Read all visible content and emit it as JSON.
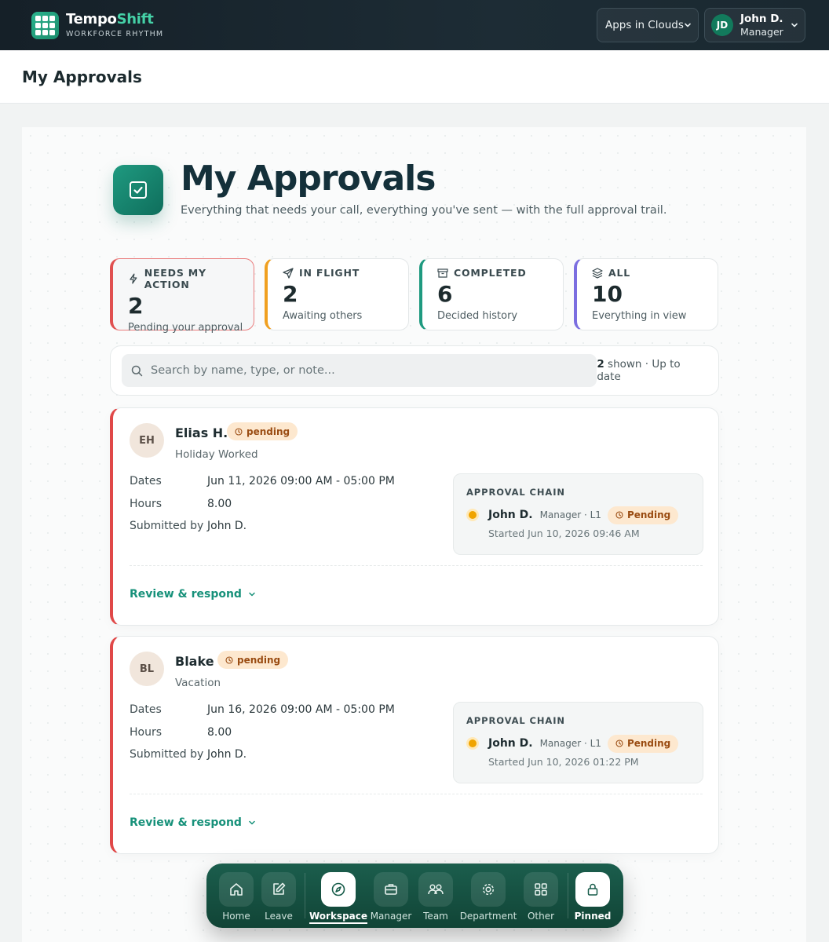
{
  "app": {
    "brand_name_part1": "Tempo",
    "brand_name_part2": "Shift",
    "brand_tagline": "WORKFORCE RHYTHM",
    "org_select": "Apps in Clouds",
    "user": {
      "initials": "JD",
      "name": "John D.",
      "role": "Manager"
    }
  },
  "page": {
    "title_bar": "My Approvals",
    "hero_title": "My Approvals",
    "hero_subtitle": "Everything that needs your call, everything you've sent — with the full approval trail."
  },
  "stats": [
    {
      "label": "NEEDS MY ACTION",
      "value": "2",
      "caption": "Pending your approval",
      "color": "#e05050",
      "icon": "bolt-icon"
    },
    {
      "label": "IN FLIGHT",
      "value": "2",
      "caption": "Awaiting others",
      "color": "#f0a020",
      "icon": "send-icon"
    },
    {
      "label": "COMPLETED",
      "value": "6",
      "caption": "Decided history",
      "color": "#1f9a80",
      "icon": "archive-icon"
    },
    {
      "label": "ALL",
      "value": "10",
      "caption": "Everything in view",
      "color": "#7b6ee0",
      "icon": "layers-icon"
    }
  ],
  "search": {
    "placeholder": "Search by name, type, or note...",
    "count": "2",
    "meta": "shown · Up to date"
  },
  "requests": [
    {
      "initials": "EH",
      "name": "Elias H.",
      "status": "pending",
      "type": "Holiday Worked",
      "dates_label": "Dates",
      "dates": "Jun 11, 2026 09:00 AM - 05:00 PM",
      "hours_label": "Hours",
      "hours": "8.00",
      "submitted_label": "Submitted by",
      "submitted_by": "John D.",
      "chain_title": "APPROVAL CHAIN",
      "chain": {
        "approver": "John D.",
        "role": "Manager · L1",
        "status": "Pending",
        "started": "Started Jun 10, 2026 09:46 AM"
      },
      "action": "Review & respond"
    },
    {
      "initials": "BL",
      "name": "Blake",
      "status": "pending",
      "type": "Vacation",
      "dates_label": "Dates",
      "dates": "Jun 16, 2026 09:00 AM - 05:00 PM",
      "hours_label": "Hours",
      "hours": "8.00",
      "submitted_label": "Submitted by",
      "submitted_by": "John D.",
      "chain_title": "APPROVAL CHAIN",
      "chain": {
        "approver": "John D.",
        "role": "Manager · L1",
        "status": "Pending",
        "started": "Started Jun 10, 2026 01:22 PM"
      },
      "action": "Review & respond"
    }
  ],
  "dock": [
    {
      "label": "Home",
      "icon": "home-icon"
    },
    {
      "label": "Leave",
      "icon": "edit-icon"
    },
    {
      "label": "Workspace",
      "icon": "compass-icon"
    },
    {
      "label": "Manager",
      "icon": "briefcase-icon"
    },
    {
      "label": "Team",
      "icon": "team-icon"
    },
    {
      "label": "Department",
      "icon": "gear-icon"
    },
    {
      "label": "Other",
      "icon": "grid-icon"
    },
    {
      "label": "Pinned",
      "icon": "lock-icon"
    }
  ]
}
